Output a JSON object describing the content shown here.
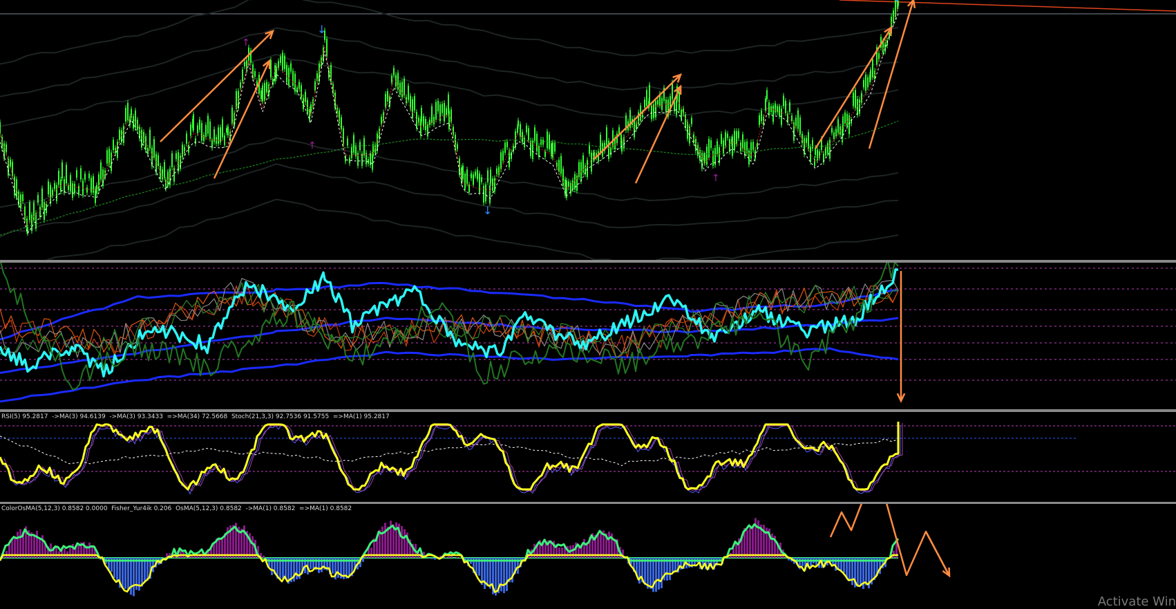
{
  "colors": {
    "background": "#000000",
    "bull_candle": "#33ff33",
    "arrow_annotation": "#ff8c40",
    "cyan_line": "#2ef4f4",
    "blue_band": "#1a2bff",
    "yellow_line": "#ffff20",
    "green_line": "#3cf07a",
    "histogram_pos": "#8a1a8a",
    "histogram_neg": "#3a66e0",
    "signal_up": "#2b8cff",
    "signal_down": "#a020a0",
    "level_dotted": "#c040c0"
  },
  "indicator_panes": {
    "rsi_stoch": {
      "label": "RSI(5) 95.2817  ->MA(3) 94.6139  ->MA(3) 93.3433  =>MA(34) 72.5668  Stoch(21,3,3) 92.7536 91.5755  =>MA(1) 95.2817"
    },
    "osma": {
      "label": "ColorOsMA(5,12,3) 0.8582 0.0000  Fisher_Yur4ik 0.206  OsMA(5,12,3) 0.8582  ->MA(1) 0.8582  =>MA(1) 0.8582"
    }
  },
  "watermark": {
    "text": "Activate Win"
  }
}
